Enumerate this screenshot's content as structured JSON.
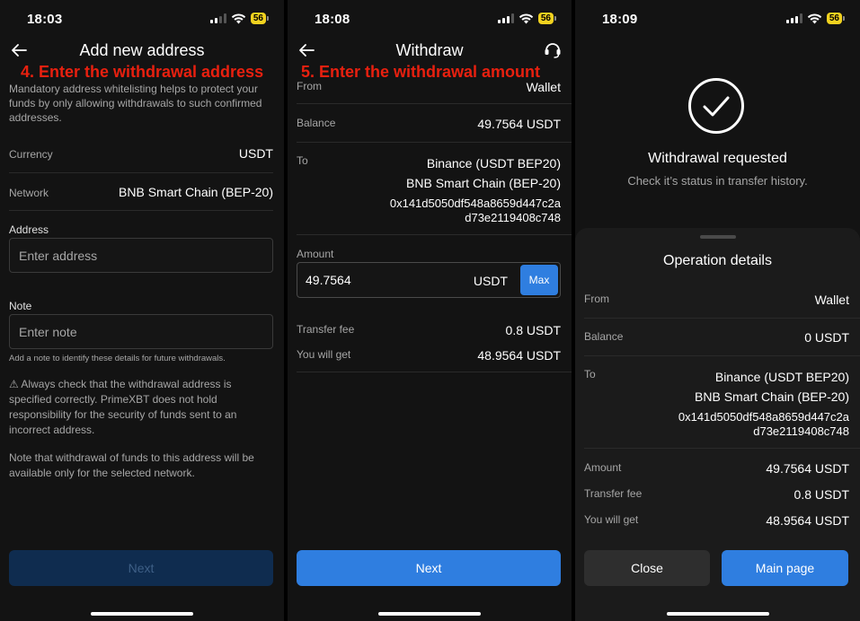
{
  "status_bars": [
    {
      "time": "18:03",
      "battery": "56"
    },
    {
      "time": "18:08",
      "battery": "56"
    },
    {
      "time": "18:09",
      "battery": "56"
    }
  ],
  "screen1": {
    "title": "Add new address",
    "annotation": "4. Enter the withdrawal address",
    "intro": "Mandatory address whitelisting helps to protect your funds by only allowing withdrawals to such confirmed addresses.",
    "currency_label": "Currency",
    "currency_value": "USDT",
    "network_label": "Network",
    "network_value": "BNB Smart Chain (BEP-20)",
    "address_label": "Address",
    "address_placeholder": "Enter address",
    "note_label": "Note",
    "note_placeholder": "Enter note",
    "note_hint": "Add a note to identify these details for future withdrawals.",
    "warning": "⚠ Always check that the withdrawal address is specified correctly. PrimeXBT does not hold responsibility for the security of funds sent to an incorrect address.",
    "network_note": "Note that withdrawal of funds to this address will be available only for the selected network.",
    "next_label": "Next"
  },
  "screen2": {
    "title": "Withdraw",
    "annotation": "5. Enter the withdrawal amount",
    "from_label": "From",
    "from_value": "Wallet",
    "balance_label": "Balance",
    "balance_value": "49.7564 USDT",
    "to_label": "To",
    "to_line1": "Binance (USDT BEP20)",
    "to_line2": "BNB Smart Chain (BEP-20)",
    "to_addr1": "0x141d5050df548a8659d447c2a",
    "to_addr2": "d73e2119408c748",
    "amount_label": "Amount",
    "amount_value": "49.7564",
    "amount_currency": "USDT",
    "max_label": "Max",
    "fee_label": "Transfer fee",
    "fee_value": "0.8 USDT",
    "get_label": "You will get",
    "get_value": "48.9564 USDT",
    "next_label": "Next"
  },
  "screen3": {
    "success_title": "Withdrawal requested",
    "success_sub": "Check it’s status in transfer history.",
    "sheet_title": "Operation details",
    "from_label": "From",
    "from_value": "Wallet",
    "balance_label": "Balance",
    "balance_value": "0 USDT",
    "to_label": "To",
    "to_line1": "Binance (USDT BEP20)",
    "to_line2": "BNB Smart Chain (BEP-20)",
    "to_addr1": "0x141d5050df548a8659d447c2a",
    "to_addr2": "d73e2119408c748",
    "amount_label": "Amount",
    "amount_value": "49.7564 USDT",
    "fee_label": "Transfer fee",
    "fee_value": "0.8 USDT",
    "get_label": "You will get",
    "get_value": "48.9564 USDT",
    "close_label": "Close",
    "main_label": "Main page"
  },
  "colors": {
    "background": "#131313",
    "accent": "#2f7ee0",
    "annotation": "#e8200f",
    "battery": "#f2d21f"
  }
}
